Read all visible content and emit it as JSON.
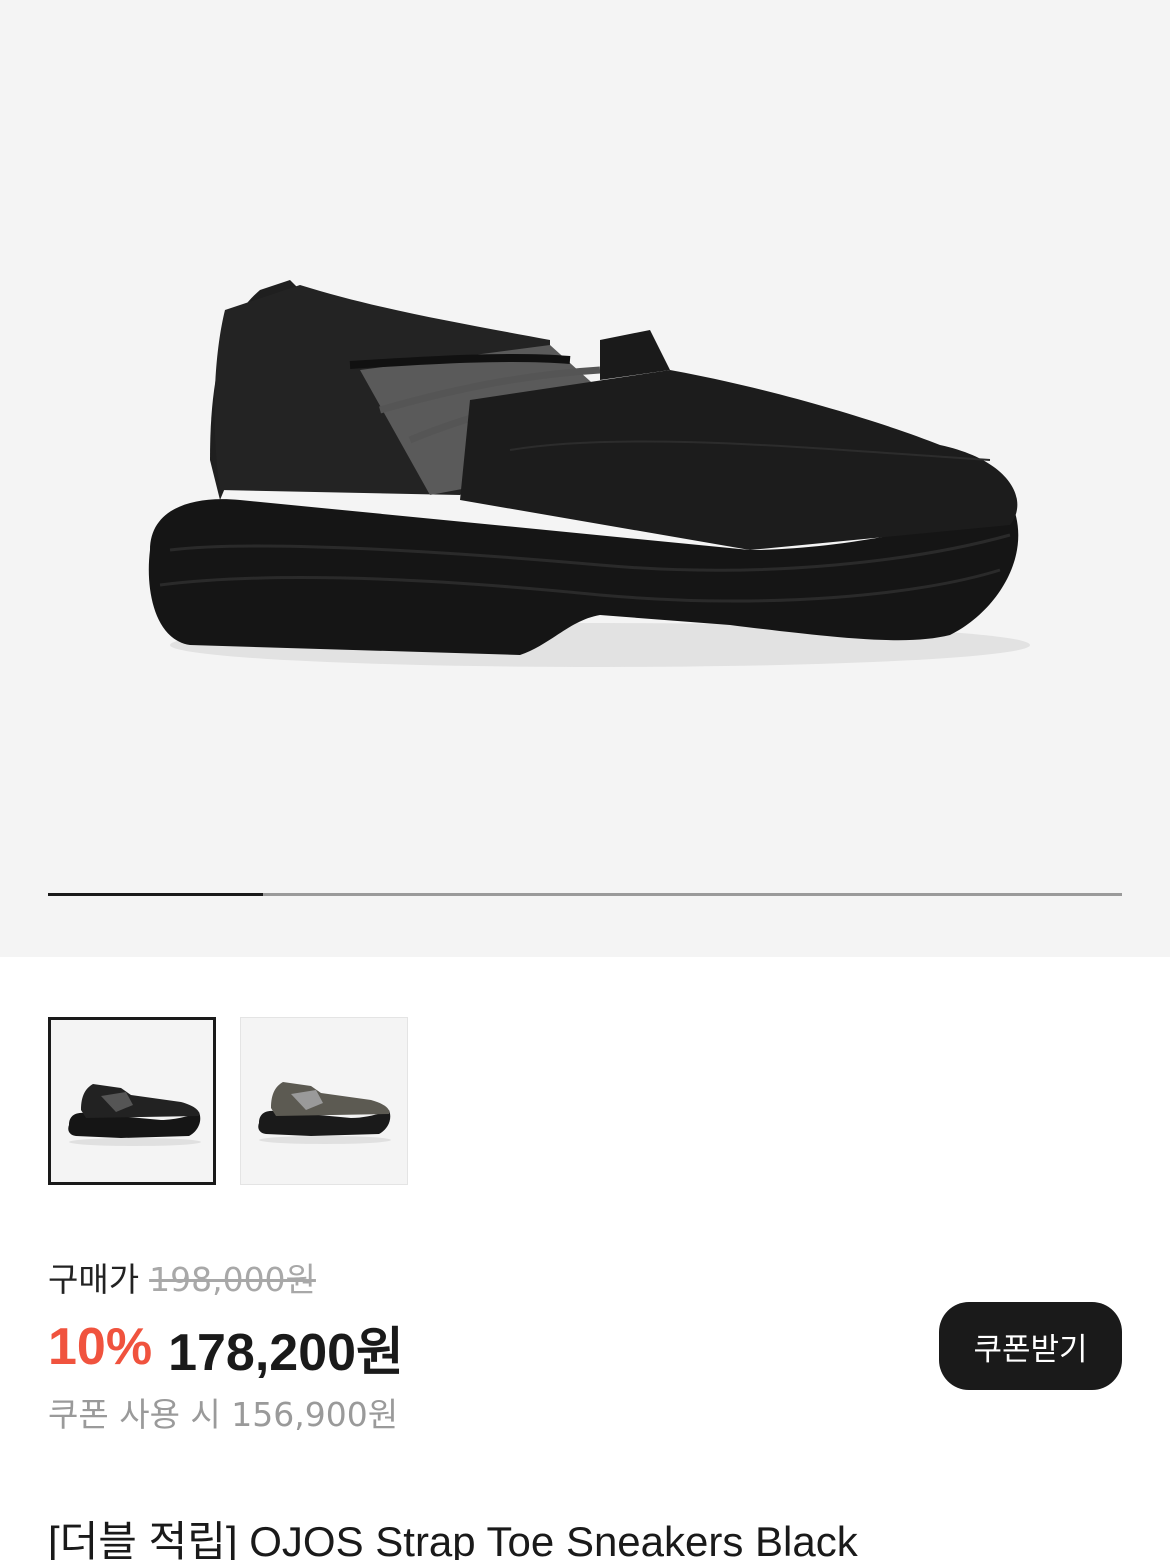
{
  "gallery": {
    "progress": 0.2,
    "thumbnails": [
      {
        "icon": "shoe-black-icon",
        "selected": true
      },
      {
        "icon": "shoe-gray-icon",
        "selected": false
      }
    ]
  },
  "pricing": {
    "label": "구매가",
    "original_price": "198,000원",
    "discount": "10%",
    "sale_price": "178,200원",
    "coupon_price": "쿠폰 사용 시 156,900원",
    "coupon_button": "쿠폰받기"
  },
  "product": {
    "title": "[더블 적립] OJOS Strap Toe Sneakers Black"
  },
  "colors": {
    "accent": "#f0533e",
    "dark": "#1a1a1a"
  }
}
